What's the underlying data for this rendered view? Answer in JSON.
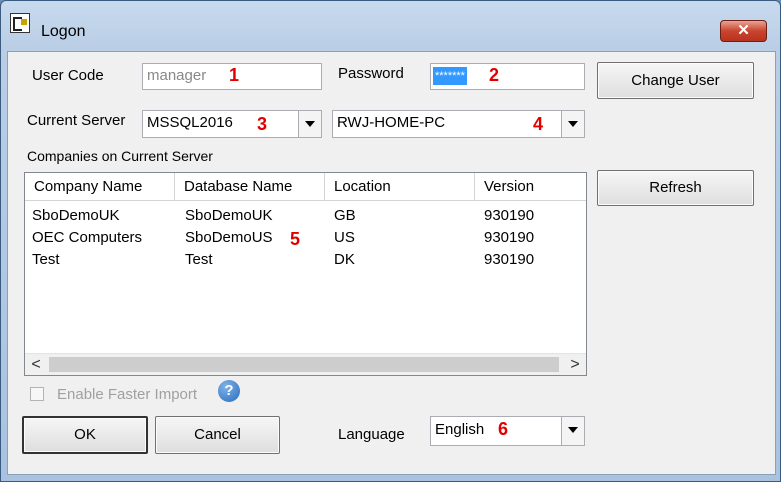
{
  "window": {
    "title": "Logon",
    "close_label": "✕"
  },
  "user_code": {
    "label": "User Code",
    "value": "manager",
    "marker": "1"
  },
  "password": {
    "label": "Password",
    "value": "*******",
    "marker": "2"
  },
  "change_user": {
    "label": "Change User"
  },
  "server": {
    "label": "Current Server",
    "type_value": "MSSQL2016",
    "type_marker": "3",
    "host_value": "RWJ-HOME-PC",
    "host_marker": "4"
  },
  "companies": {
    "label": "Companies on Current Server",
    "marker": "5",
    "columns": [
      "Company Name",
      "Database Name",
      "Location",
      "Version"
    ],
    "rows": [
      [
        "SboDemoUK",
        "SboDemoUK",
        "GB",
        "930190"
      ],
      [
        "OEC Computers",
        "SboDemoUS",
        "US",
        "930190"
      ],
      [
        "Test",
        "Test",
        "DK",
        "930190"
      ]
    ],
    "scroll_left": "<",
    "scroll_right": ">"
  },
  "refresh": {
    "label": "Refresh"
  },
  "faster_import": {
    "label": "Enable Faster Import",
    "checked": false,
    "help_icon": "?"
  },
  "ok": {
    "label": "OK"
  },
  "cancel": {
    "label": "Cancel"
  },
  "language": {
    "label": "Language",
    "value": "English",
    "marker": "6"
  },
  "colors": {
    "marker_red": "#e00000",
    "selection_blue": "#3399ff"
  }
}
